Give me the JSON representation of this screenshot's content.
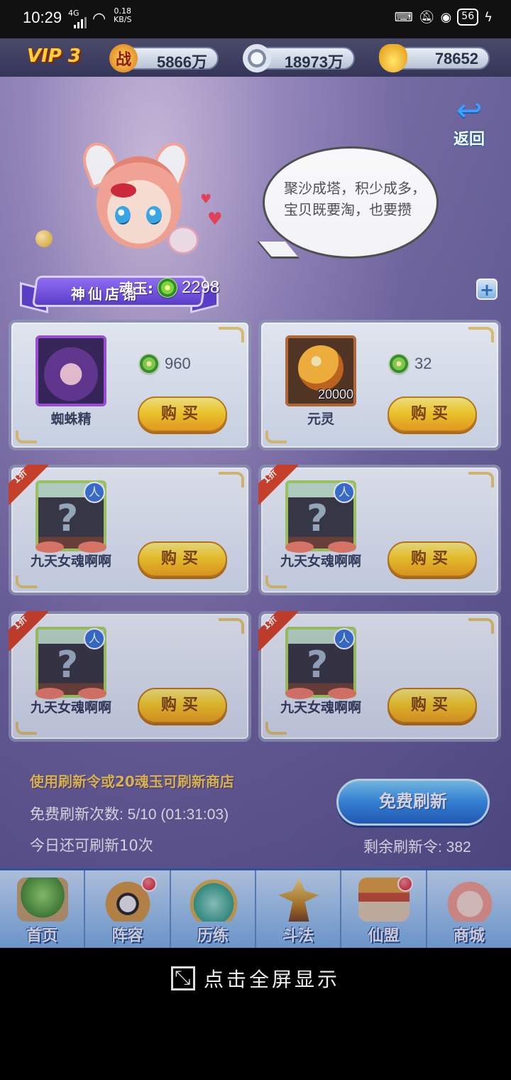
{
  "status_bar": {
    "time": "10:29",
    "network": "4G",
    "speed_value": "0.18",
    "speed_unit": "KB/S",
    "battery": "56"
  },
  "topbar": {
    "vip": "VIP 3",
    "power_icon_text": "战",
    "power": "5866万",
    "silver": "18973万",
    "gold": "78652"
  },
  "back_button": {
    "label": "返回"
  },
  "shop": {
    "title": "神仙店铺",
    "soul_label": "魂玉:",
    "soul_jade": "2298",
    "speech": "聚沙成塔，积少成多，宝贝既要淘，也要攒"
  },
  "items": [
    {
      "name": "蜘蛛精",
      "price": "960",
      "buy": "购买"
    },
    {
      "name": "元灵",
      "price": "32",
      "amount": "20000",
      "buy": "购买"
    },
    {
      "name": "九天女魂啊啊",
      "discount": "1折",
      "badge": "人",
      "buy": "购买"
    },
    {
      "name": "九天女魂啊啊",
      "discount": "1折",
      "badge": "人",
      "buy": "购买"
    },
    {
      "name": "九天女魂啊啊",
      "discount": "1折",
      "badge": "人",
      "buy": "购买"
    },
    {
      "name": "九天女魂啊啊",
      "discount": "1折",
      "badge": "人",
      "buy": "购买"
    }
  ],
  "refresh": {
    "note": "使用刷新令或20魂玉可刷新商店",
    "free_count": "免费刷新次数: 5/10 (01:31:03)",
    "today": "今日还可刷新10次",
    "free_button": "免费刷新",
    "tokens": "剩余刷新令: 382"
  },
  "nav": [
    {
      "label": "首页",
      "badge": false
    },
    {
      "label": "阵容",
      "badge": true
    },
    {
      "label": "历练",
      "badge": false
    },
    {
      "label": "斗法",
      "badge": false
    },
    {
      "label": "仙盟",
      "badge": true
    },
    {
      "label": "商城",
      "badge": false
    }
  ],
  "fullscreen_hint": "点击全屏显示",
  "colors": {
    "gold_button": "#ffd21a",
    "blue_button": "#2f93f0",
    "accent_text": "#ffd34a"
  }
}
